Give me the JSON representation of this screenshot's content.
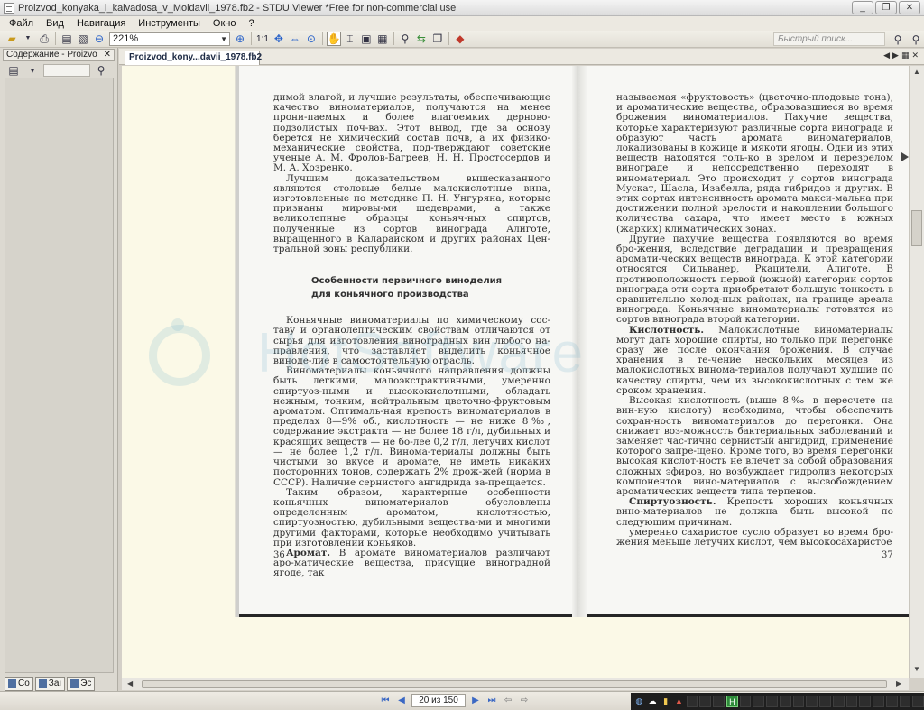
{
  "window": {
    "title": "Proizvod_konyaka_i_kalvadosa_v_Moldavii_1978.fb2 - STDU Viewer *Free for non-commercial use",
    "minimize": "_",
    "maximize": "❐",
    "close": "✕"
  },
  "menu": [
    "Файл",
    "Вид",
    "Навигация",
    "Инструменты",
    "Окно",
    "?"
  ],
  "toolbar": {
    "zoom_value": "221%",
    "page_width_label": "1:1",
    "search_placeholder": "Быстрый поиск..."
  },
  "sidebar": {
    "panel_title": "Содержание - Proizvo",
    "close": "✕",
    "tabs": [
      "Co",
      "Зaı",
      "Эc"
    ]
  },
  "document_tab": {
    "label": "Proizvod_kony...davii_1978.fb2"
  },
  "watermark": "HotSoftware",
  "book": {
    "left_page": {
      "number": "36",
      "para1": "димой влагой, и лучшие результаты, обеспечивающие качество виноматериалов, получаются на менее прони-паемых и более влагоемких дерново-подзолистых поч-вах. Этот вывод, где за основу берется не химический состав почв, а их физико-механические свойства, под-тверждают советские ученые А. М. Фролов-Багреев, Н. Н. Простосердов и М. А. Хозренко.",
      "para2": "Лучшим доказательством вышесказанного являются столовые белые малокислотные вина, изготовленные по методике П. Н. Унгуряна, которые признаны мировы-ми шедеврами, а также великолепные образцы коньяч-ных спиртов, полученные из сортов винограда Алиготе, выращенного в Калараиском и других районах Цен-тральной зоны республики.",
      "heading_line1": "Особенности первичного виноделия",
      "heading_line2": "для коньячного производства",
      "para3": "Коньячные виноматериалы по химическому сос-таву и органолептическим свойствам отличаются от сырья для изготовления виноградных вин любого на-правления, что заставляет выделить коньячное виноде-лие в самостоятельную отрасль.",
      "para4": "Виноматериалы коньячного направления должны быть легкими, малоэкстрактивными, умеренно спиртуоз-ными и высококислотными, обладать нежным, тонким, нейтральным цветочно-фруктовым ароматом. Оптималь-ная крепость виноматериалов в пределах 8—9% об., кислотность — не ниже 8‰, содержание экстракта — не более 18 г/л, дубильных и красящих веществ — не бо-лее 0,2 г/л, летучих кислот — не более 1,2 г/л. Винома-териалы должны быть чистыми во вкусе и аромате, не иметь никаких посторонних тонов, содержать 2% дрож-жей (норма в СССР). Наличие сернистого ангидрида за-прещается.",
      "para5": "Таким образом, характерные особенности коньячных виноматериалов обусловлены определенным ароматом, кислотностью, спиртуозностью, дубильными вещества-ми и многими другими факторами, которые необходимо учитывать при изготовлении коньяков.",
      "para6_bold": "Аромат.",
      "para6": " В аромате виноматериалов различают аро-матические вещества, присущие виноградной ягоде, так"
    },
    "right_page": {
      "number": "37",
      "para1": "называемая «фруктовость» (цветочно-плодовые тона), и ароматические вещества, образовавшиеся во время брожения виноматериалов. Пахучие вещества, которые характеризуют различные сорта винограда и образуют часть аромата виноматериалов, локализованы в кожице и мякоти ягоды. Одни из этих веществ находятся толь-ко в зрелом и перезрелом винограде и непосредственно переходят в виноматериал. Это происходит у сортов винограда Мускат, Шасла, Изабелла, ряда гибридов и других. В этих сортах интенсивность аромата макси-мальна при достижении полной зрелости и накоплении большого количества сахара, что имеет место в южных (жарких) климатических зонах.",
      "para2": "Другие пахучие вещества появляются во время бро-жения, вследствие деградации и превращения аромати-ческих веществ винограда. К этой категории относятся Сильванер, Ркацители, Алиготе. В противоположность первой (южной) категории сортов винограда эти сорта приобретают большую тонкость в сравнительно холод-ных районах, на границе ареала винограда. Коньячные виноматериалы готовятся из сортов винограда второй категории.",
      "para3_bold": "Кислотность.",
      "para3": " Малокислотные виноматериалы могут дать хорошие спирты, но только при перегонке сразу же после окончания брожения. В случае хранения в те-чение нескольких месяцев из малокислотных винома-териалов получают худшие по качеству спирты, чем из высококислотных с тем же сроком хранения.",
      "para4": "Высокая кислотность (выше 8‰ в пересчете на вин-ную кислоту) необходима, чтобы обеспечить сохран-ность виноматериалов до перегонки. Она снижает воз-можность бактериальных заболеваний и заменяет час-тично сернистый ангидрид, применение которого запре-щено. Кроме того, во время перегонки высокая кислот-ность не влечет за собой образования сложных эфиров, но возбуждает гидролиз некоторых компонентов вино-материалов с высвобождением ароматических веществ типа терпенов.",
      "para5_bold": "Спиртуозность.",
      "para5": " Крепость хороших коньячных вино-материалов не должна быть высокой по следующим причинам.",
      "para6": "умеренно сахаристое сусло образует во время бро-жения меньше летучих кислот, чем высокосахаристое"
    }
  },
  "status": {
    "page_indicator": "20 из 150"
  }
}
